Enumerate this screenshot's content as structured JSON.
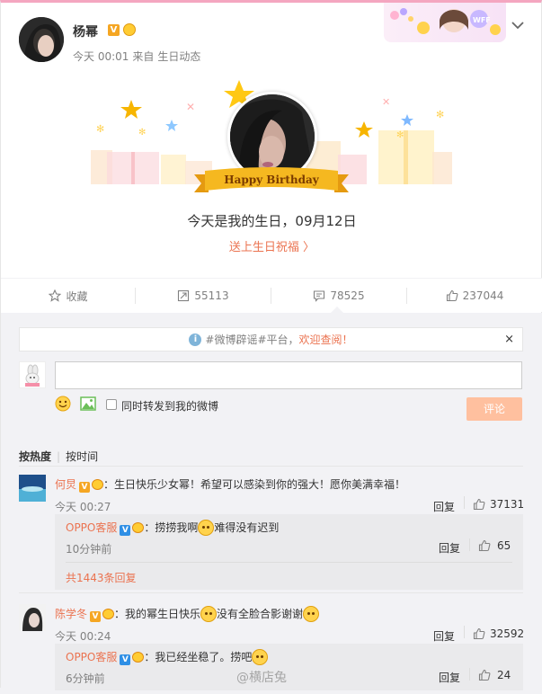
{
  "post": {
    "username": "杨幂",
    "verified_badge": "V",
    "time": "今天 00:01",
    "source_prefix": "来自",
    "source": "生日动态",
    "birthday_banner": "Happy Birthday",
    "birthday_message": "今天是我的生日，09月12日",
    "birthday_link": "送上生日祝福 〉"
  },
  "actions": {
    "favorite_label": "收藏",
    "repost_count": "55113",
    "comment_count": "78525",
    "like_count": "237044"
  },
  "comment_area": {
    "notice_prefix": "#微博辟谣#平台，",
    "notice_link": "欢迎查阅！",
    "notice_close": "×",
    "input_value": "",
    "repost_option": "同时转发到我的微博",
    "submit_label": "评论"
  },
  "sort": {
    "hot": "按热度",
    "time": "按时间"
  },
  "comments": [
    {
      "name": "何炅",
      "text": "：生日快乐少女幂！希望可以感染到你的强大！愿你美满幸福！",
      "time": "今天 00:27",
      "reply_label": "回复",
      "likes": "37131",
      "reply": {
        "name": "OPPO客服",
        "text_a": "：捞捞我啊",
        "text_b": "难得没有迟到",
        "time": "10分钟前",
        "reply_label": "回复",
        "likes": "65",
        "more": "共1443条回复"
      }
    },
    {
      "name": "陈学冬",
      "text_a": "：我的幂生日快乐",
      "text_b": "没有全脸合影谢谢",
      "time": "今天 00:24",
      "reply_label": "回复",
      "likes": "32592",
      "reply": {
        "name": "OPPO客服",
        "text_a": "：我已经坐稳了。捞吧",
        "time": "6分钟前",
        "reply_label": "回复",
        "likes": "24"
      }
    }
  ],
  "watermark": "@横店兔",
  "colors": {
    "accent": "#eb7350",
    "muted": "#808080",
    "panel_bg": "#f2f2f5",
    "submit_disabled": "#ffc09f",
    "ribbon": "#f5a623"
  },
  "icons": [
    "verified-v-icon",
    "member-crown-icon",
    "chevron-down-icon",
    "star-icon",
    "repost-icon",
    "comment-icon",
    "like-thumb-icon",
    "info-icon",
    "close-icon",
    "emoji-icon",
    "picture-icon",
    "smiley-emoji-icon"
  ]
}
